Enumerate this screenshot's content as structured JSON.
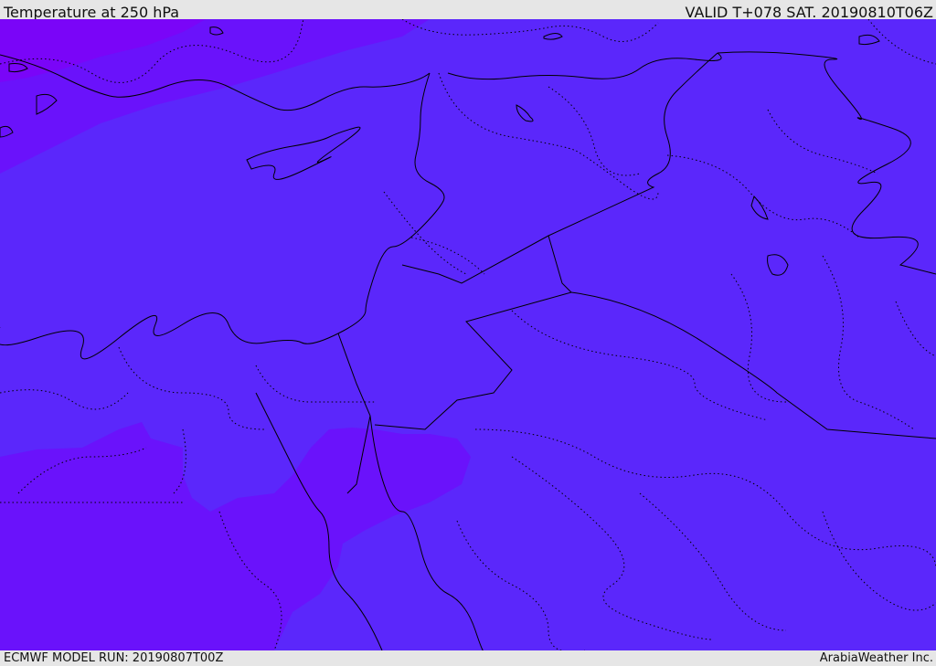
{
  "header": {
    "title": "Temperature at 250 hPa",
    "valid": "VALID T+078 SAT. 20190810T06Z"
  },
  "footer": {
    "model_run": "ECMWF MODEL RUN: 20190807T00Z",
    "credit": "ArabiaWeather Inc."
  },
  "colors": {
    "main_field": "#5b27fb",
    "cold_band": "#6a12fb",
    "coldest_band": "#7a05f8",
    "borders": "#000000",
    "frame": "#e6e6e6"
  }
}
